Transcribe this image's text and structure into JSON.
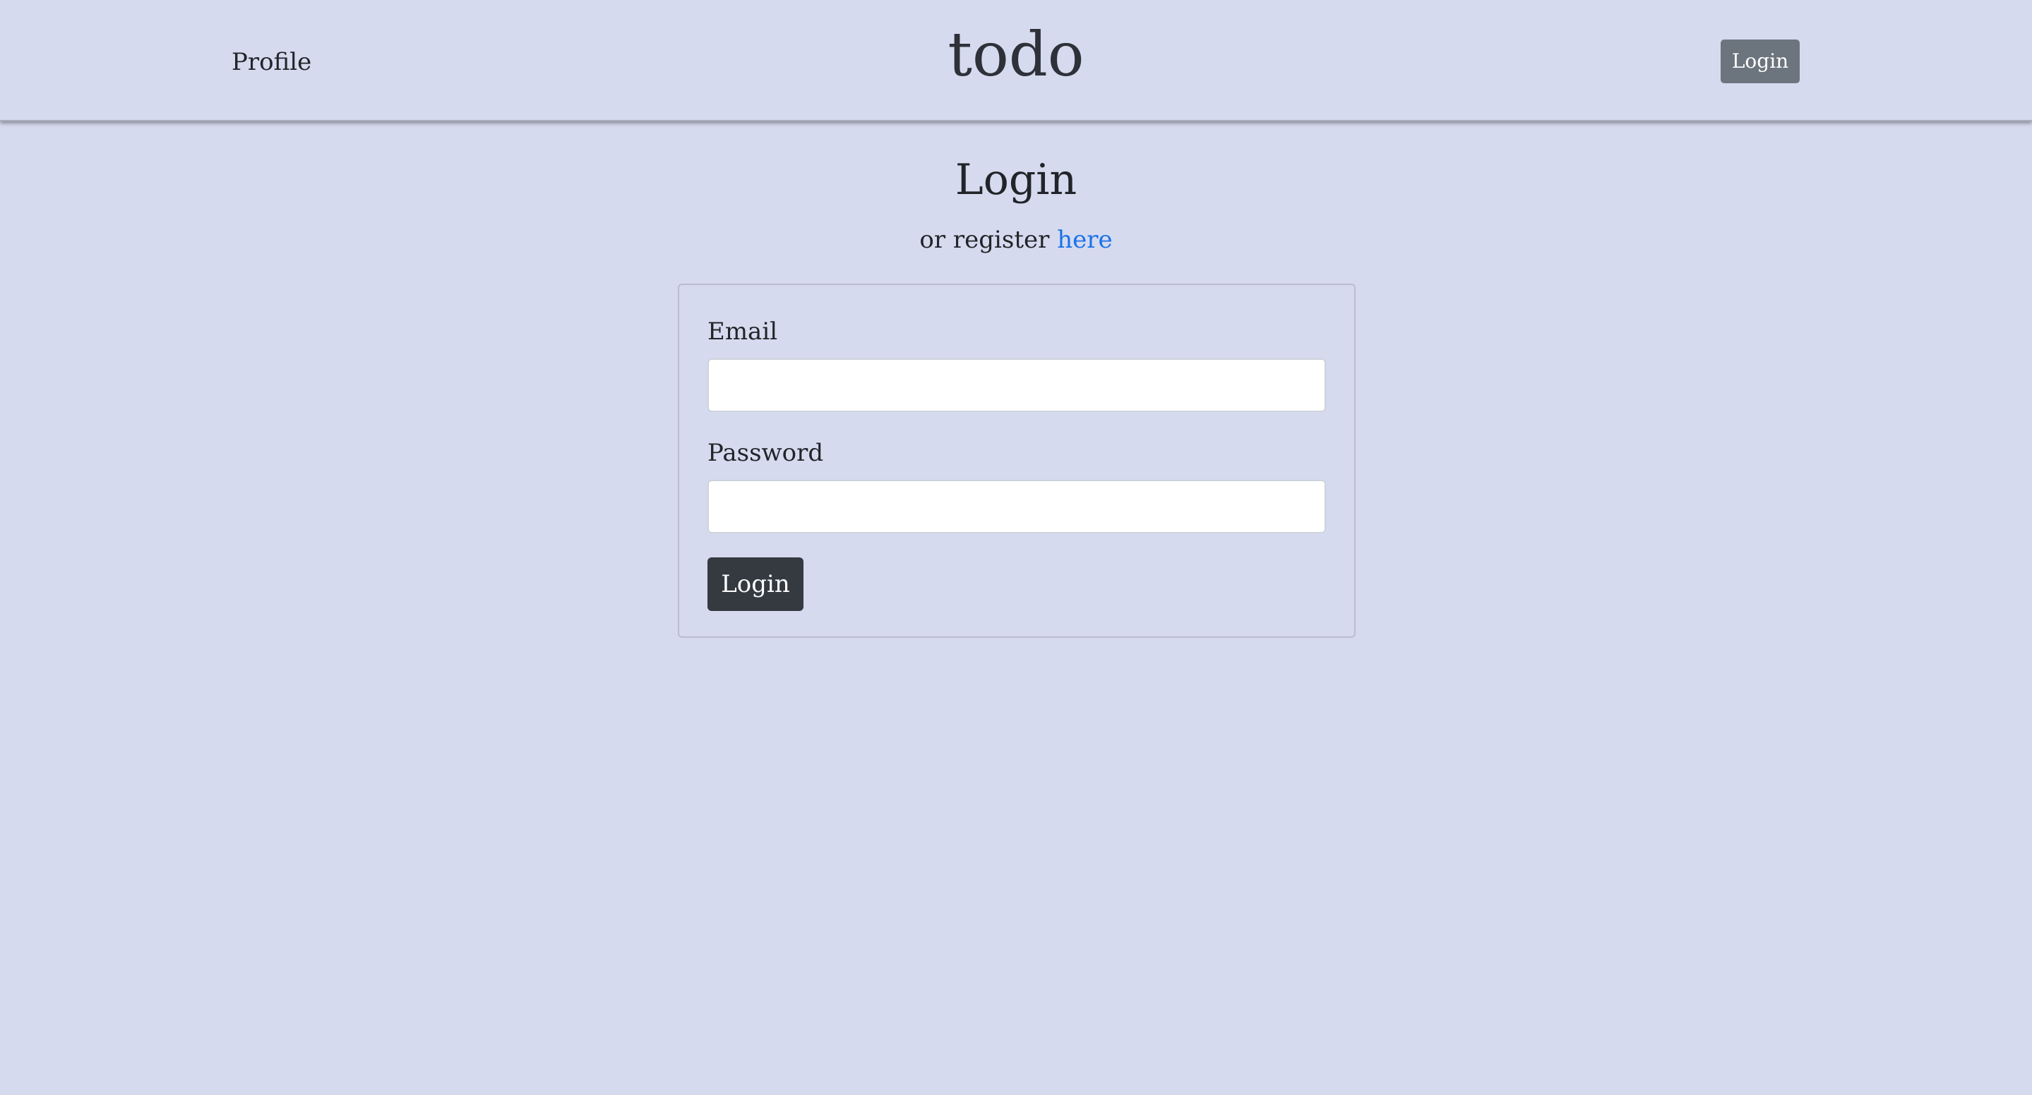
{
  "header": {
    "profile_link": "Profile",
    "brand": "todo",
    "login_button": "Login"
  },
  "main": {
    "title": "Login",
    "register_prefix": "or register ",
    "register_link": "here"
  },
  "form": {
    "email_label": "Email",
    "email_value": "",
    "password_label": "Password",
    "password_value": "",
    "submit_label": "Login"
  },
  "colors": {
    "background": "#d6daef",
    "login_button_header": "#6c757d",
    "submit_button": "#343a40",
    "link": "#1a73e8"
  }
}
